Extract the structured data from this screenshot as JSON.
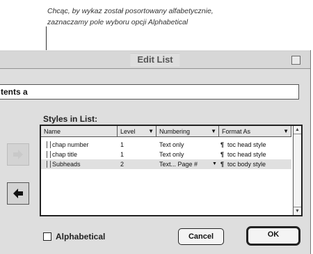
{
  "caption": {
    "line1": "Chcąc, by wykaz został posortowany alfabetycznie,",
    "line2": "zaznaczamy pole wyboru opcji Alphabetical"
  },
  "dialog": {
    "title": "Edit List",
    "name_field_value": "tents a"
  },
  "styles_in_list": {
    "label": "Styles in List:",
    "columns": [
      {
        "label": "Name",
        "has_menu": false
      },
      {
        "label": "Level",
        "has_menu": true
      },
      {
        "label": "Numbering",
        "has_menu": true
      },
      {
        "label": "Format As",
        "has_menu": true
      }
    ],
    "rows": [
      {
        "name": "chap number",
        "level": "1",
        "numbering": "Text only",
        "format_as": "toc head style",
        "selected": false
      },
      {
        "name": "chap title",
        "level": "1",
        "numbering": "Text only",
        "format_as": "toc head style",
        "selected": false
      },
      {
        "name": "Subheads",
        "level": "2",
        "numbering": "Text... Page #",
        "format_as": "toc body style",
        "selected": true
      }
    ]
  },
  "alphabetical": {
    "label": "Alphabetical",
    "checked": false
  },
  "buttons": {
    "cancel": "Cancel",
    "ok": "OK"
  },
  "icons": {
    "add_arrow": "right-arrow-icon",
    "remove_arrow": "left-arrow-icon",
    "format_marker": "pilcrow-icon"
  }
}
